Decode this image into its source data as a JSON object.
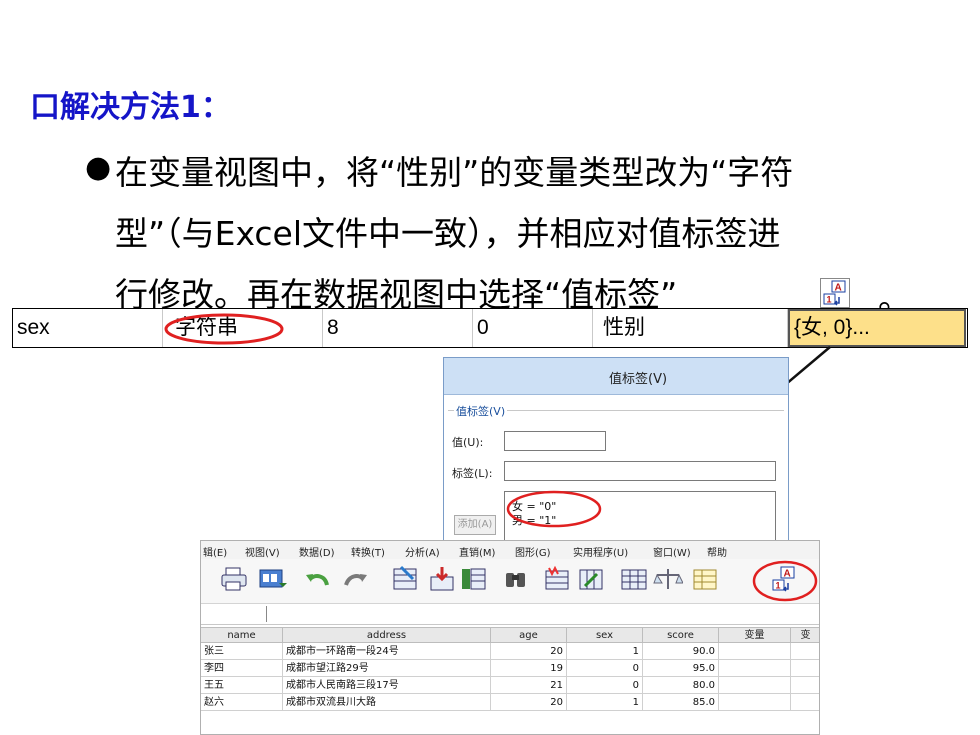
{
  "slide": {
    "title": "口解决方法1：",
    "bullet_symbol": "●",
    "bullet_lines": [
      "在变量视图中，将“性别”的变量类型改为“字符",
      "型”（与Excel文件中一致），并相应对值标签进",
      "行修改。再在数据视图中选择“值标签”"
    ],
    "trailing_period": "。",
    "value_labels_icon": "value-labels-icon"
  },
  "variable_row": {
    "name": "sex",
    "type": "字符串",
    "width": "8",
    "decimals": "0",
    "label": "性别",
    "values": "{女, 0}..."
  },
  "dialog": {
    "title": "值标签(V)",
    "group_label": "值标签(V)",
    "value_label": "值(U):",
    "label_label": "标签(L):",
    "add_button": "添加(A)",
    "items": [
      "女 = \"0\"",
      "男 = \"1\""
    ]
  },
  "spss": {
    "menu": [
      "辑(E)",
      "视图(V)",
      "数据(D)",
      "转换(T)",
      "分析(A)",
      "直销(M)",
      "图形(G)",
      "实用程序(U)",
      "窗口(W)",
      "帮助"
    ],
    "toolbar_icons": [
      "print-icon",
      "dialog-recall-icon",
      "undo-icon",
      "redo-icon",
      "goto-case-icon",
      "goto-variable-icon",
      "variables-icon",
      "find-icon",
      "insert-cases-icon",
      "insert-variable-icon",
      "split-file-icon",
      "weight-cases-icon",
      "select-cases-icon",
      "value-labels-icon"
    ],
    "columns": [
      "name",
      "address",
      "age",
      "sex",
      "score",
      "变量",
      "变"
    ],
    "rows": [
      {
        "name": "张三",
        "address": "成都市一环路南一段24号",
        "age": "20",
        "sex": "1",
        "score": "90.0"
      },
      {
        "name": "李四",
        "address": "成都市望江路29号",
        "age": "19",
        "sex": "0",
        "score": "95.0"
      },
      {
        "name": "王五",
        "address": "成都市人民南路三段17号",
        "age": "21",
        "sex": "0",
        "score": "80.0"
      },
      {
        "name": "赵六",
        "address": "成都市双流县川大路",
        "age": "20",
        "sex": "1",
        "score": "85.0"
      }
    ]
  },
  "colors": {
    "title": "#1515c8",
    "highlight_circle": "#e02020",
    "selected_cell": "#fde08a"
  }
}
